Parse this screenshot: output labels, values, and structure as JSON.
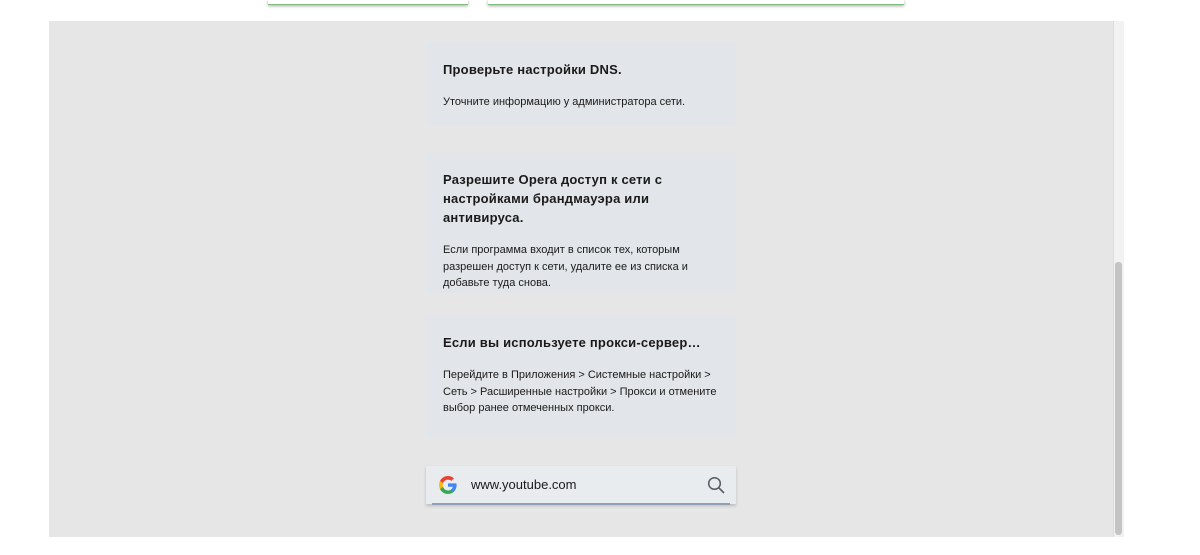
{
  "cards": [
    {
      "title": "Проверьте настройки DNS.",
      "body": "Уточните информацию у администратора сети."
    },
    {
      "title": "Разрешите Opera доступ к сети с настройками брандмауэра или антивируса.",
      "body": "Если программа входит в список тех, которым разрешен доступ к сети, удалите ее из списка и добавьте туда снова."
    },
    {
      "title": "Если вы используете прокси-сервер…",
      "body": "Перейдите в Приложения > Системные настройки > Сеть > Расширенные настройки > Прокси и отмените выбор ранее отмеченных прокси."
    }
  ],
  "search": {
    "value": "www.youtube.com",
    "engine_icon": "google-g-icon",
    "action_icon": "search-icon"
  },
  "colors": {
    "page_background": "#e6e6e6",
    "card_background": "#e2e5e9",
    "search_underline": "#8fa0b6"
  }
}
